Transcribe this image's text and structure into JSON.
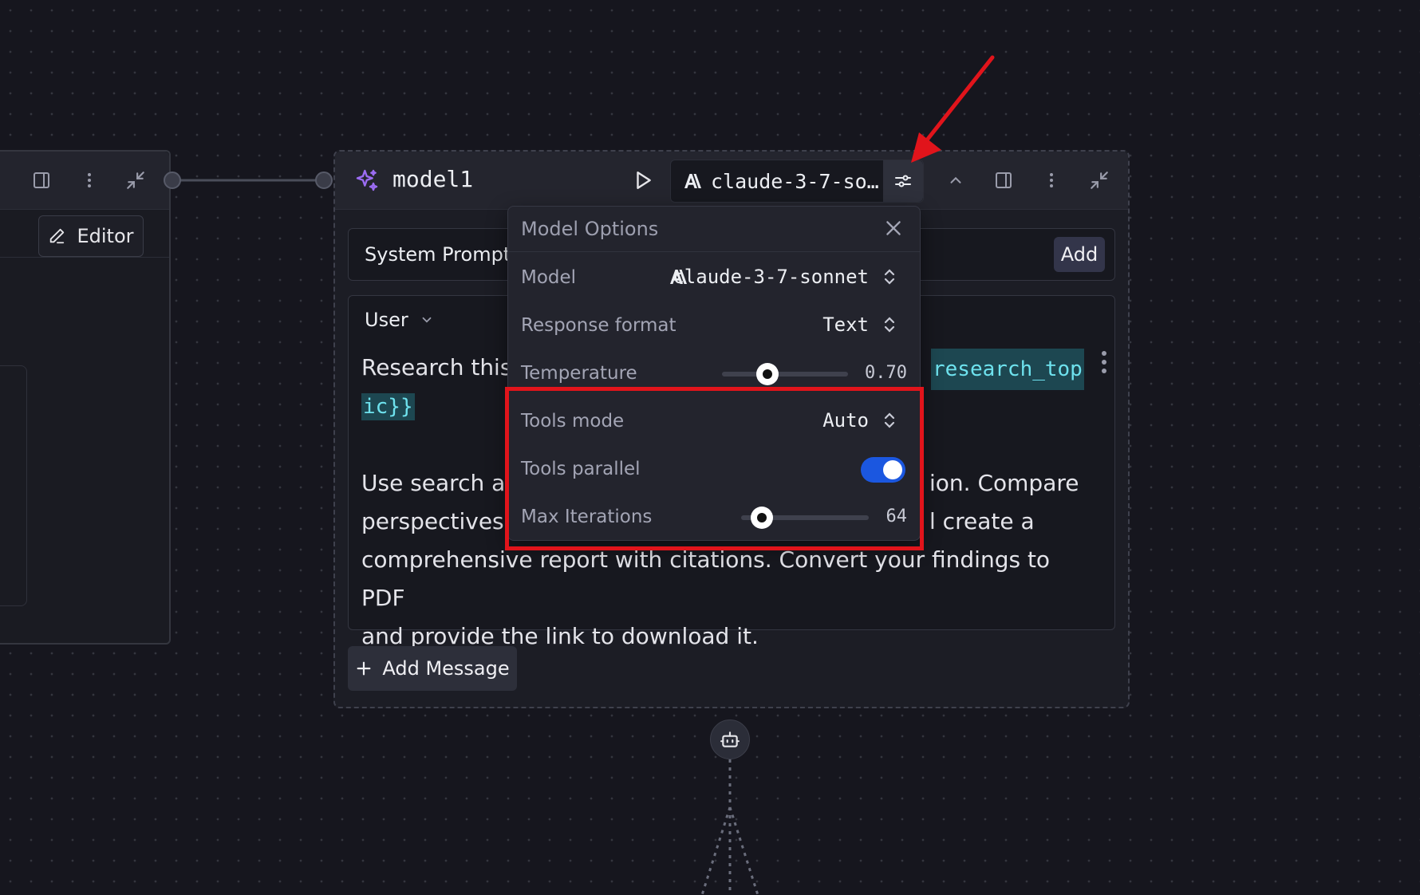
{
  "left_node": {
    "editor_label": "Editor"
  },
  "main_node": {
    "title": "model1",
    "model_chip_label": "claude-3-7-so…",
    "system_prompt_label": "System Prompt",
    "add_label": "Add",
    "role_label": "User",
    "message": {
      "line1_prefix": "Research this",
      "variable_part1": "research_top",
      "variable_part2": "ic}}",
      "line3_start": "Use search ar",
      "line3_end": "ion. Compare",
      "line4_start": "perspectives,",
      "line4_end": "l create a",
      "line5": "comprehensive report with citations. Convert your findings to PDF",
      "line6": "and provide the link to download it."
    },
    "add_message_label": "Add Message"
  },
  "model_options": {
    "title": "Model Options",
    "model_label": "Model",
    "model_value": "claude-3-7-sonnet",
    "response_format_label": "Response format",
    "response_format_value": "Text",
    "temperature_label": "Temperature",
    "temperature_value": "0.70",
    "temperature_fraction": 0.36,
    "tools_mode_label": "Tools mode",
    "tools_mode_value": "Auto",
    "tools_parallel_label": "Tools parallel",
    "tools_parallel_on": true,
    "max_iterations_label": "Max Iterations",
    "max_iterations_value": "64",
    "max_iterations_fraction": 0.16
  },
  "annotation_colors": {
    "highlight": "#e1141b",
    "toggle_on": "#1b57e0",
    "variable_bg": "#1d4751",
    "variable_text": "#6ee2ee",
    "sparkle": "#9b6cf2"
  }
}
